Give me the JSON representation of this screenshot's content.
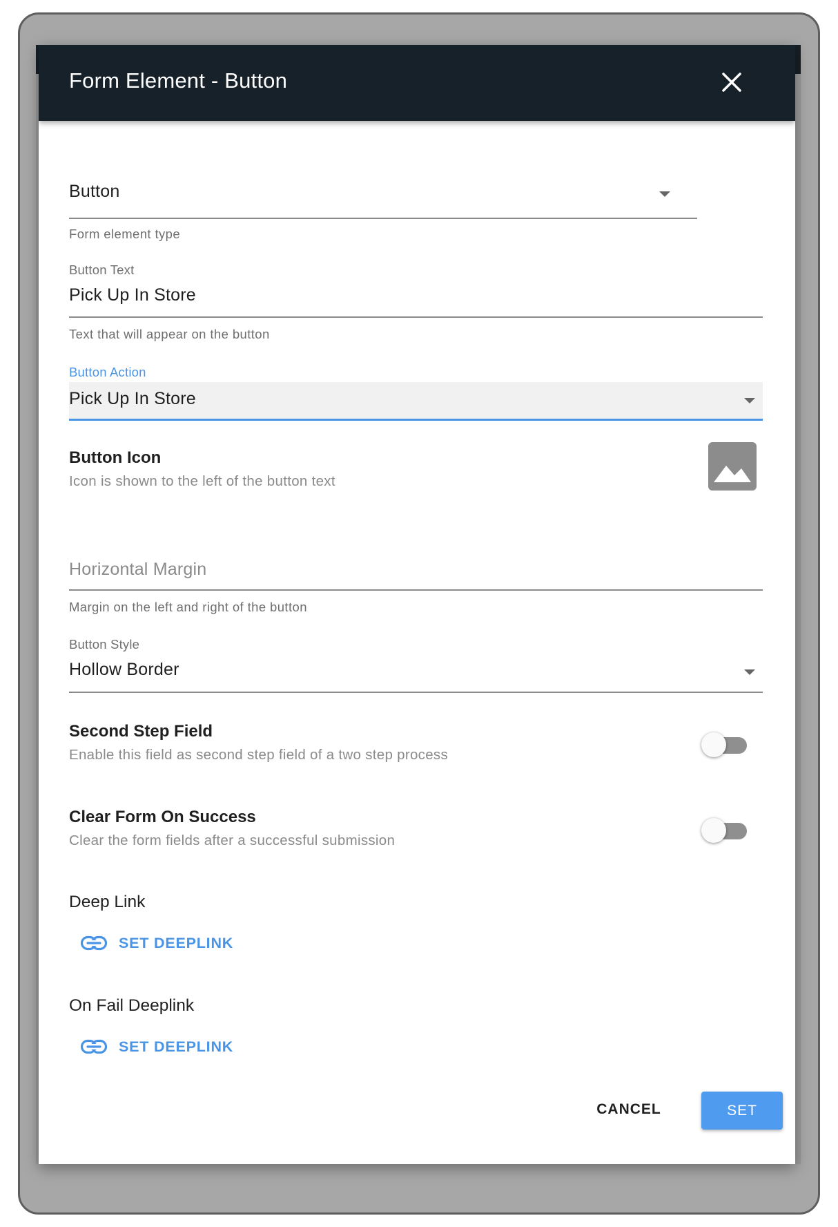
{
  "dialog": {
    "title": "Form Element - Button"
  },
  "fields": {
    "element_type": {
      "value": "Button",
      "helper": "Form element type"
    },
    "button_text": {
      "label": "Button Text",
      "value": "Pick Up In Store",
      "helper": "Text that will appear on the button"
    },
    "button_action": {
      "label": "Button Action",
      "value": "Pick Up In Store"
    },
    "button_icon": {
      "title": "Button Icon",
      "description": "Icon is shown to the left of the button text",
      "icon": "image-icon"
    },
    "horizontal_margin": {
      "placeholder": "Horizontal Margin",
      "helper": "Margin on the left and right of the button"
    },
    "button_style": {
      "label": "Button Style",
      "value": "Hollow Border"
    },
    "second_step": {
      "title": "Second Step Field",
      "description": "Enable this field as second step field of a two step process",
      "enabled": false
    },
    "clear_form": {
      "title": "Clear Form On Success",
      "description": "Clear the form fields after a successful submission",
      "enabled": false
    },
    "deep_link": {
      "title": "Deep Link",
      "button_label": "SET DEEPLINK",
      "icon": "link-icon"
    },
    "fail_deep_link": {
      "title": "On Fail Deeplink",
      "button_label": "SET DEEPLINK",
      "icon": "link-icon"
    }
  },
  "actions": {
    "cancel_label": "CANCEL",
    "set_label": "SET"
  },
  "colors": {
    "header_bg": "#17212a",
    "accent": "#4a94e6",
    "primary_button": "#4f9bef"
  }
}
